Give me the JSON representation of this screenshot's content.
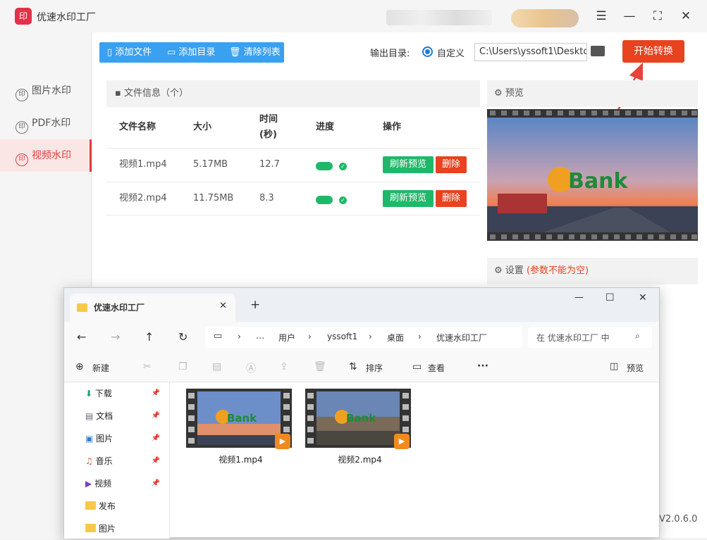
{
  "app": {
    "logo_text": "印",
    "title": "优速水印工厂"
  },
  "window_controls": {
    "menu": "☰",
    "minimize": "—",
    "maximize": "⛶",
    "close": "✕"
  },
  "sidebar": {
    "items": [
      {
        "label": "图片水印",
        "icon": "印",
        "active": false
      },
      {
        "label": "PDF水印",
        "icon": "印",
        "active": false
      },
      {
        "label": "视频水印",
        "icon": "印",
        "active": true
      }
    ]
  },
  "toolbar": {
    "add_file": "添加文件",
    "add_dir": "添加目录",
    "clear_list": "清除列表"
  },
  "output": {
    "label": "输出目录:",
    "option": "自定义",
    "path": "C:\\Users\\yssoft1\\Deskto",
    "start_button": "开始转换"
  },
  "file_table": {
    "header": "文件信息（个）",
    "columns": [
      "文件名称",
      "大小",
      "时间",
      "(秒)",
      "进度",
      "操作"
    ],
    "rows": [
      {
        "name": "视频1.mp4",
        "size": "5.17MB",
        "duration": "12.7",
        "progress": 1.0,
        "refresh": "刷新预览",
        "delete": "删除"
      },
      {
        "name": "视频2.mp4",
        "size": "11.75MB",
        "duration": "8.3",
        "progress": 1.0,
        "refresh": "刷新预览",
        "delete": "删除"
      }
    ]
  },
  "preview": {
    "header": "预览",
    "watermark": "Bank"
  },
  "settings": {
    "header": "设置",
    "note": "(参数不能为空)"
  },
  "version": "V2.0.6.0",
  "explorer": {
    "tab_title": "优速水印工厂",
    "tab_close": "✕",
    "new_tab": "+",
    "win_min": "—",
    "win_max": "☐",
    "win_close": "✕",
    "breadcrumb": [
      "…",
      "用户",
      "yssoft1",
      "桌面",
      "优速水印工厂"
    ],
    "search_placeholder": "在 优速水印工厂 中",
    "commands": {
      "new": "新建",
      "sort": "排序",
      "view": "查看",
      "more": "···",
      "preview": "预览"
    },
    "nav_items": [
      {
        "label": "下载",
        "icon": "download-icon",
        "pinned": true
      },
      {
        "label": "文档",
        "icon": "document-icon",
        "pinned": true
      },
      {
        "label": "图片",
        "icon": "picture-icon",
        "pinned": true
      },
      {
        "label": "音乐",
        "icon": "music-icon",
        "pinned": true
      },
      {
        "label": "视频",
        "icon": "video-icon",
        "pinned": true
      },
      {
        "label": "发布",
        "icon": "folder-icon",
        "pinned": false
      },
      {
        "label": "图片",
        "icon": "folder-icon",
        "pinned": false
      }
    ],
    "files": [
      {
        "name": "视频1.mp4",
        "watermark": "Bank"
      },
      {
        "name": "视频2.mp4",
        "watermark": "Bank"
      }
    ]
  },
  "colors": {
    "accent_red": "#e8421f",
    "accent_blue": "#3aa0f0",
    "success_green": "#1fb86a",
    "brand_red": "#e03c3c"
  }
}
